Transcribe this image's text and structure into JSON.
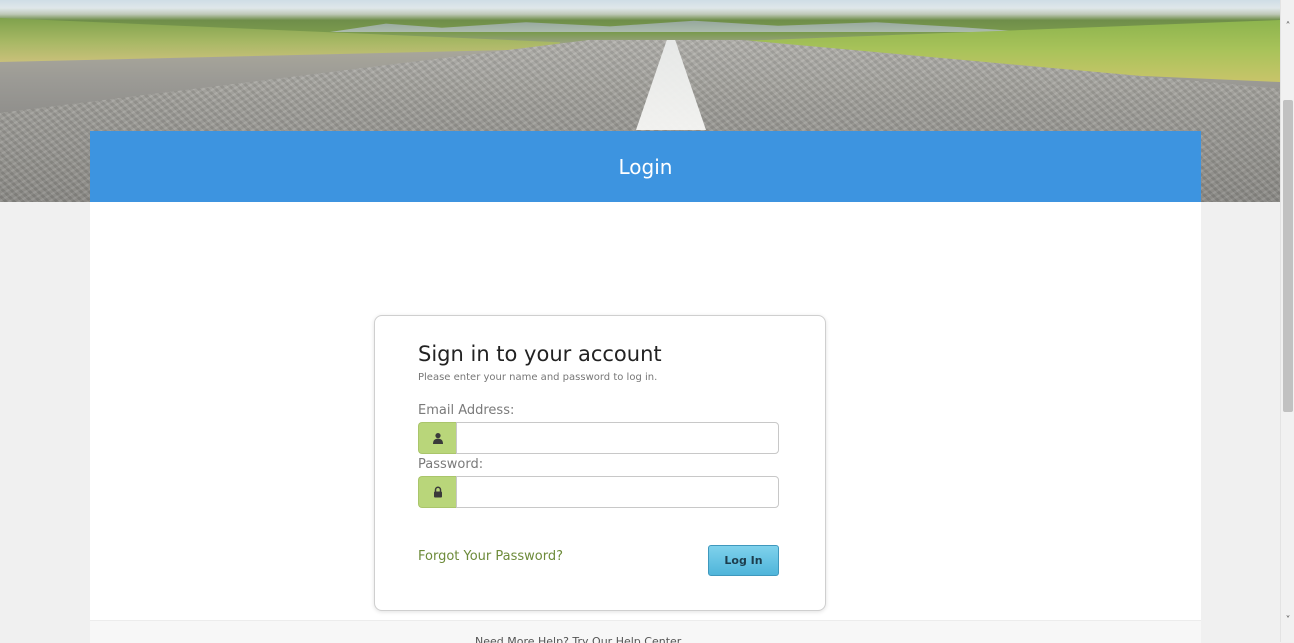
{
  "header": {
    "title": "Login"
  },
  "login_card": {
    "title": "Sign in to your account",
    "subtitle": "Please enter your name and password to log in.",
    "email": {
      "label": "Email Address:",
      "value": "",
      "placeholder": "",
      "icon": "user-icon"
    },
    "password": {
      "label": "Password:",
      "value": "",
      "placeholder": "",
      "icon": "lock-icon"
    },
    "forgot_link": "Forgot Your Password?",
    "login_button": "Log In"
  },
  "footer": {
    "text": "Need More Help? Try Our Help Center"
  },
  "colors": {
    "header_bg": "#3d94e0",
    "addon_bg": "#b9d67a",
    "link": "#6d8b3a",
    "button_bg": "#4fb5da"
  }
}
